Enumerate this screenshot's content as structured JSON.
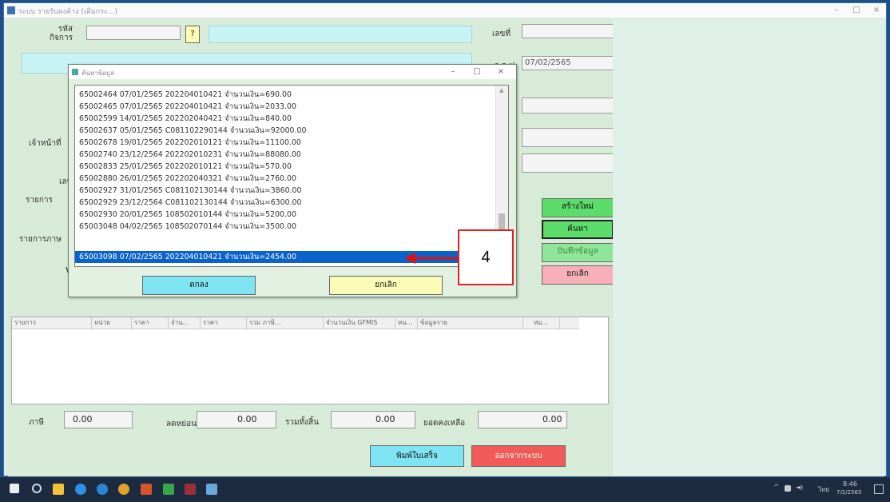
{
  "window": {
    "title": "ระบบ รายรับคงค้าง (เดิมกระ...)",
    "controls": [
      "–",
      "□",
      "×"
    ]
  },
  "form": {
    "code_label": "รหัส\nกิจการ",
    "lookup_button": "?",
    "id_label": "เลขที่",
    "date_label": "ว.ด.ป.",
    "date_value": "07/02/2565",
    "receive_label": "เจ้าหน้าที่",
    "label_no": "เลข",
    "label_list1": "รายการ",
    "label_list2": "รายการภาษ",
    "label_v": "V"
  },
  "actions": {
    "new": "สร้างใหม่",
    "search": "ค้นหา",
    "save": "บันทึกข้อมูล",
    "cancel": "ยกเลิก"
  },
  "dialog": {
    "title": "ค้นหาข้อมูล",
    "controls": [
      "–",
      "□",
      "×"
    ],
    "items": [
      "65002464 07/01/2565 202204010421 จำนวนเงิน=690.00",
      "65002465 07/01/2565 202204010421 จำนวนเงิน=2033.00",
      "65002599 14/01/2565 202202040421 จำนวนเงิน=840.00",
      "65002637 05/01/2565 C081102290144 จำนวนเงิน=92000.00",
      "65002678 19/01/2565 202202010121 จำนวนเงิน=11100.00",
      "65002740 23/12/2564 202202010231 จำนวนเงิน=88080.00",
      "65002833 25/01/2565 202202010121 จำนวนเงิน=570.00",
      "65002880 26/01/2565 202202040321 จำนวนเงิน=2760.00",
      "65002927 31/01/2565 C081102130144 จำนวนเงิน=3860.00",
      "65002929 23/12/2564 C081102130144 จำนวนเงิน=6300.00",
      "65002930 20/01/2565 108502010144 จำนวนเงิน=5200.00",
      "65003048 04/02/2565 108502070144 จำนวนเงิน=3500.00",
      "65003098 07/02/2565 202204010421 จำนวนเงิน=2454.00"
    ],
    "selected_index": 12,
    "ok_button": "ตกลง",
    "cancel_button": "ยกเลิก"
  },
  "callout": {
    "label": "4"
  },
  "grid": {
    "columns": [
      "รายการ",
      "หน่วย",
      "ราคา",
      "จำน...",
      "ราคา",
      "รวม ภาษี...",
      "จำนวนเงิน GFMIS",
      "หน...",
      "ข้อมูลราย",
      "หม..."
    ]
  },
  "totals": {
    "tax_label": "ภาษี",
    "tax_value": "0.00",
    "discount_label": "ลดหย่อน",
    "discount_value": "0.00",
    "net_label": "รวมทั้งสิ้น",
    "net_value": "0.00",
    "remaining_label": "ยอดคงเหลือ",
    "remaining_value": "0.00"
  },
  "bottom_buttons": {
    "print": "พิมพ์ใบเสร็จ",
    "close": "ออกจากระบบ"
  },
  "taskbar": {
    "tray_time": "8:46",
    "tray_date": "7/2/2565",
    "lang": "ไทย"
  },
  "colors": {
    "dialog_bg": "#e3f1e3",
    "selection": "#0a62cc",
    "callout_border": "#dd2222",
    "arrow": "#dd1111",
    "btn_green": "#5cdc6a",
    "btn_pink": "#f7b0b8",
    "btn_cyan": "#7fe4f2",
    "btn_yellow": "#fbfbb8"
  }
}
